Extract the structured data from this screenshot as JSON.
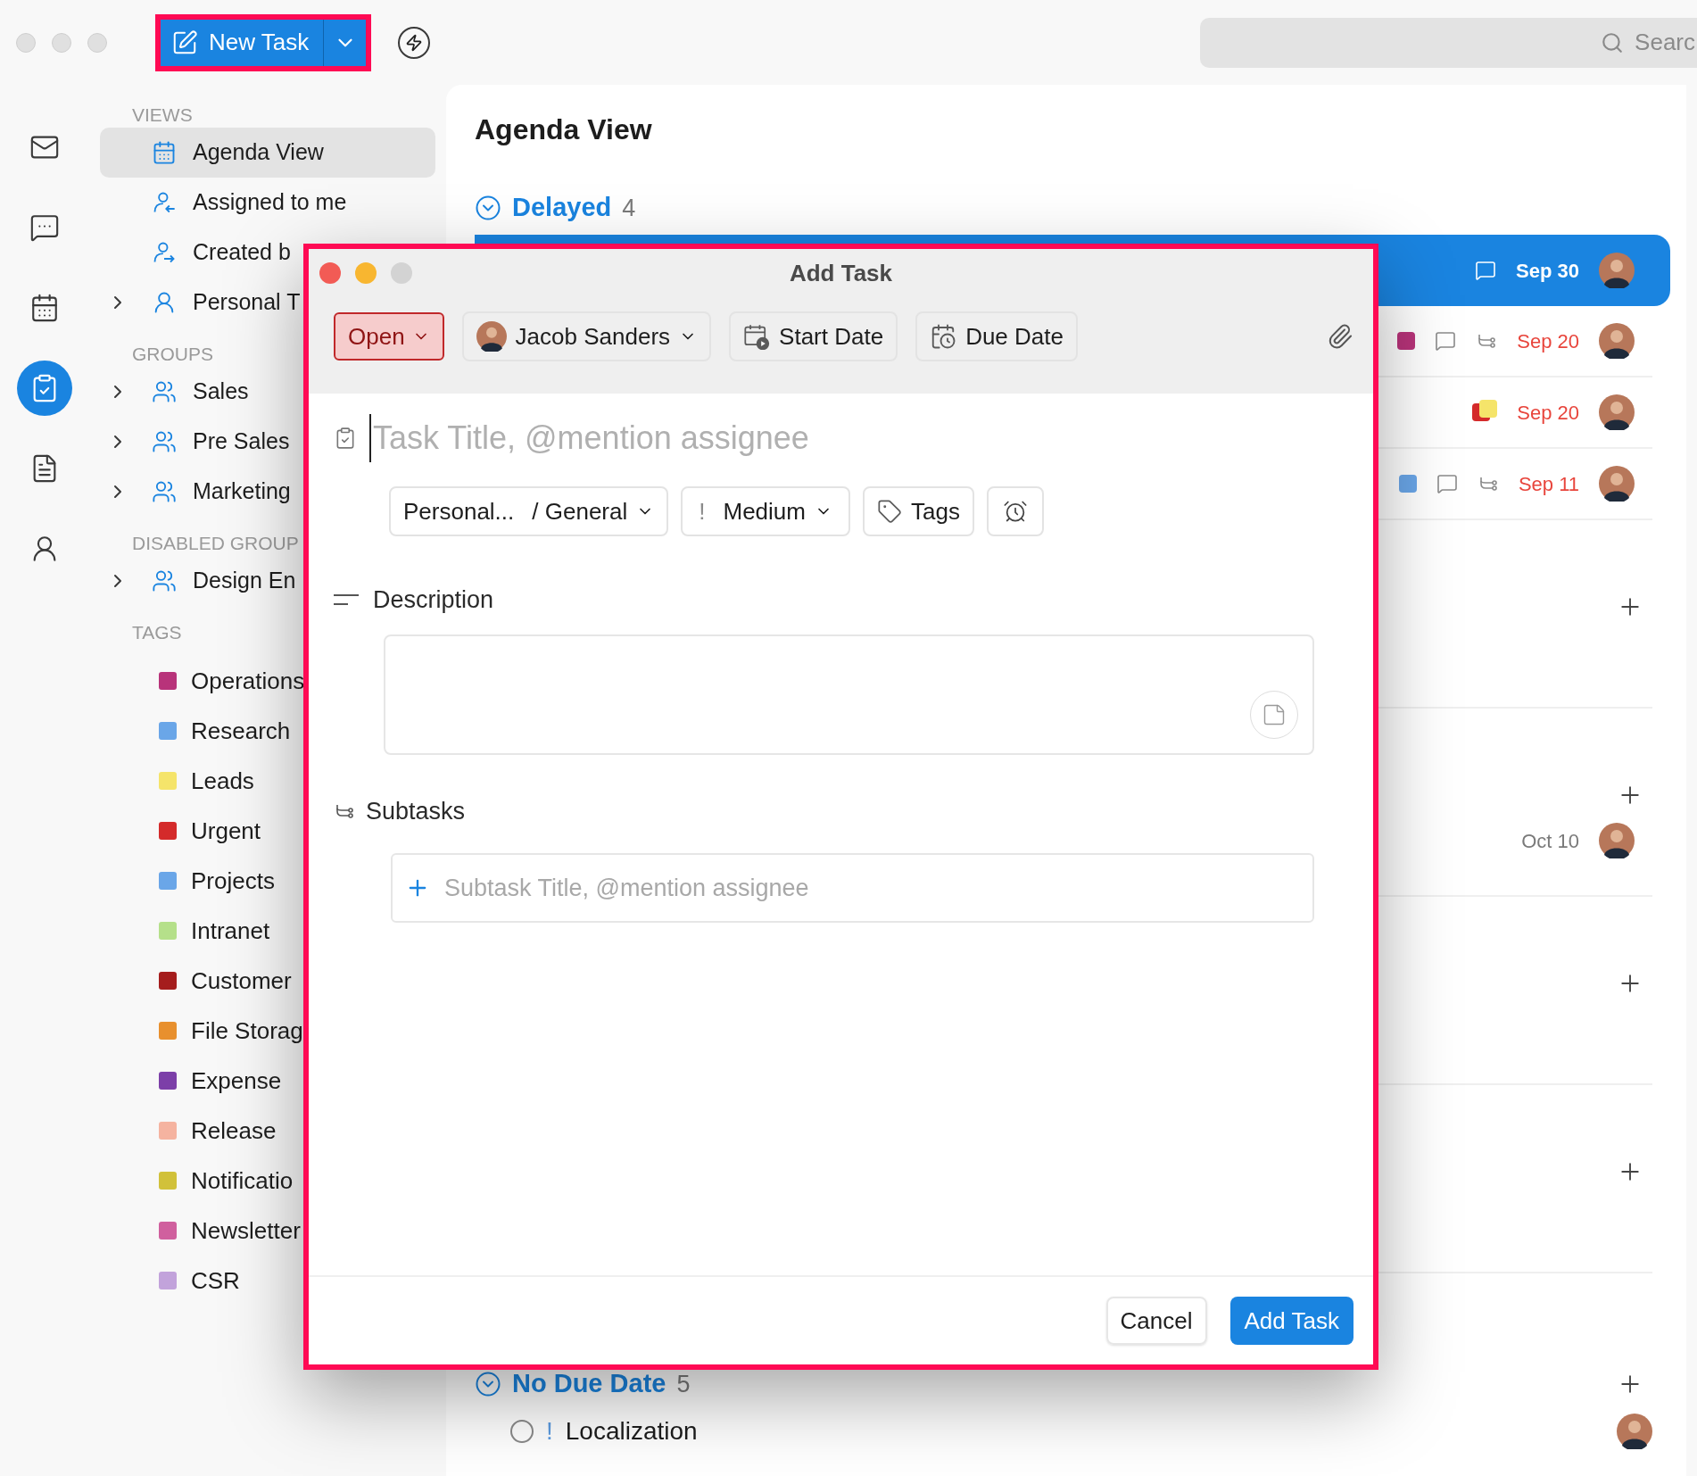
{
  "toolbar": {
    "new_task_button": {
      "label": "New Task"
    },
    "search": {
      "placeholder": "Searc"
    }
  },
  "rail": [
    {
      "selected": false
    },
    {
      "selected": false
    },
    {
      "selected": false
    },
    {
      "selected": true
    },
    {
      "selected": false
    },
    {
      "selected": false
    }
  ],
  "sidebar": {
    "sections": [
      {
        "title": "VIEWS",
        "items": [
          {
            "label": "Agenda View",
            "expandable": false,
            "selected": true
          },
          {
            "label": "Assigned to me",
            "expandable": false,
            "selected": false
          },
          {
            "label": "Created b",
            "expandable": false,
            "selected": false
          },
          {
            "label": "Personal T",
            "expandable": true,
            "selected": false
          }
        ]
      },
      {
        "title": "GROUPS",
        "items": [
          {
            "label": "Sales",
            "expandable": true,
            "selected": false
          },
          {
            "label": "Pre Sales",
            "expandable": true,
            "selected": false
          },
          {
            "label": "Marketing",
            "expandable": true,
            "selected": false
          }
        ]
      },
      {
        "title": "DISABLED GROUP",
        "items": [
          {
            "label": "Design En",
            "expandable": true,
            "selected": false
          }
        ]
      }
    ],
    "tags_title": "TAGS",
    "tags": [
      {
        "label": "Operations",
        "color": "#b8337a"
      },
      {
        "label": "Research",
        "color": "#6aa6e8"
      },
      {
        "label": "Leads",
        "color": "#f5e46a"
      },
      {
        "label": "Urgent",
        "color": "#d42a2a"
      },
      {
        "label": "Projects",
        "color": "#6aa6e8"
      },
      {
        "label": "Intranet",
        "color": "#b5e08a"
      },
      {
        "label": "Customer",
        "color": "#a51d1d"
      },
      {
        "label": "File Storag",
        "color": "#e8902e"
      },
      {
        "label": "Expense",
        "color": "#7c3fa8"
      },
      {
        "label": "Release",
        "color": "#f5b3a0"
      },
      {
        "label": "Notificatio",
        "color": "#d1c13a"
      },
      {
        "label": "Newsletter",
        "color": "#d0609e"
      },
      {
        "label": "CSR",
        "color": "#c2a3db"
      }
    ]
  },
  "main": {
    "title": "Agenda View",
    "delayed": {
      "title": "Delayed",
      "count": "4",
      "expanded": true,
      "tasks": [
        {
          "selected": true,
          "comments": true,
          "due": "Sep 30",
          "overdue": true
        },
        {
          "selected": false,
          "tags": [
            {
              "color": "#b8337a"
            }
          ],
          "comments": true,
          "subtasks": true,
          "due": "Sep 20",
          "overdue": true
        },
        {
          "selected": false,
          "tags": [
            {
              "color": "#d42a2a"
            },
            {
              "color": "#f5e46a"
            }
          ],
          "due": "Sep 20",
          "overdue": true
        },
        {
          "selected": false,
          "tags": [
            {
              "color": "#6aa6e8"
            }
          ],
          "comments": true,
          "subtasks": true,
          "due": "Sep 11",
          "overdue": true
        }
      ]
    },
    "days": [
      {
        "addable": true
      },
      {
        "addable": true,
        "tasks": [
          {
            "selected": false,
            "due": "Oct 10",
            "overdue": false
          }
        ]
      },
      {
        "addable": true
      },
      {
        "addable": true
      }
    ],
    "no_due": {
      "title": "No Due Date",
      "count": "5",
      "expanded": true,
      "addable": true,
      "tasks": [
        {
          "title": "Localization",
          "priority_mark": "!",
          "checked": false
        }
      ]
    }
  },
  "dialog": {
    "title": "Add Task",
    "status": {
      "label": "Open"
    },
    "assignee": {
      "label": "Jacob Sanders"
    },
    "start_date": {
      "label": "Start Date"
    },
    "due_date": {
      "label": "Due Date"
    },
    "title_field": {
      "placeholder": "Task Title, @mention assignee"
    },
    "project": {
      "label": "Personal...",
      "list": "/ General"
    },
    "priority": {
      "mark": "!",
      "label": "Medium"
    },
    "tags": {
      "label": "Tags"
    },
    "description": {
      "label": "Description"
    },
    "subtasks": {
      "label": "Subtasks",
      "field": {
        "placeholder": "Subtask Title, @mention assignee"
      }
    },
    "buttons": {
      "cancel": "Cancel",
      "submit": "Add Task"
    }
  }
}
